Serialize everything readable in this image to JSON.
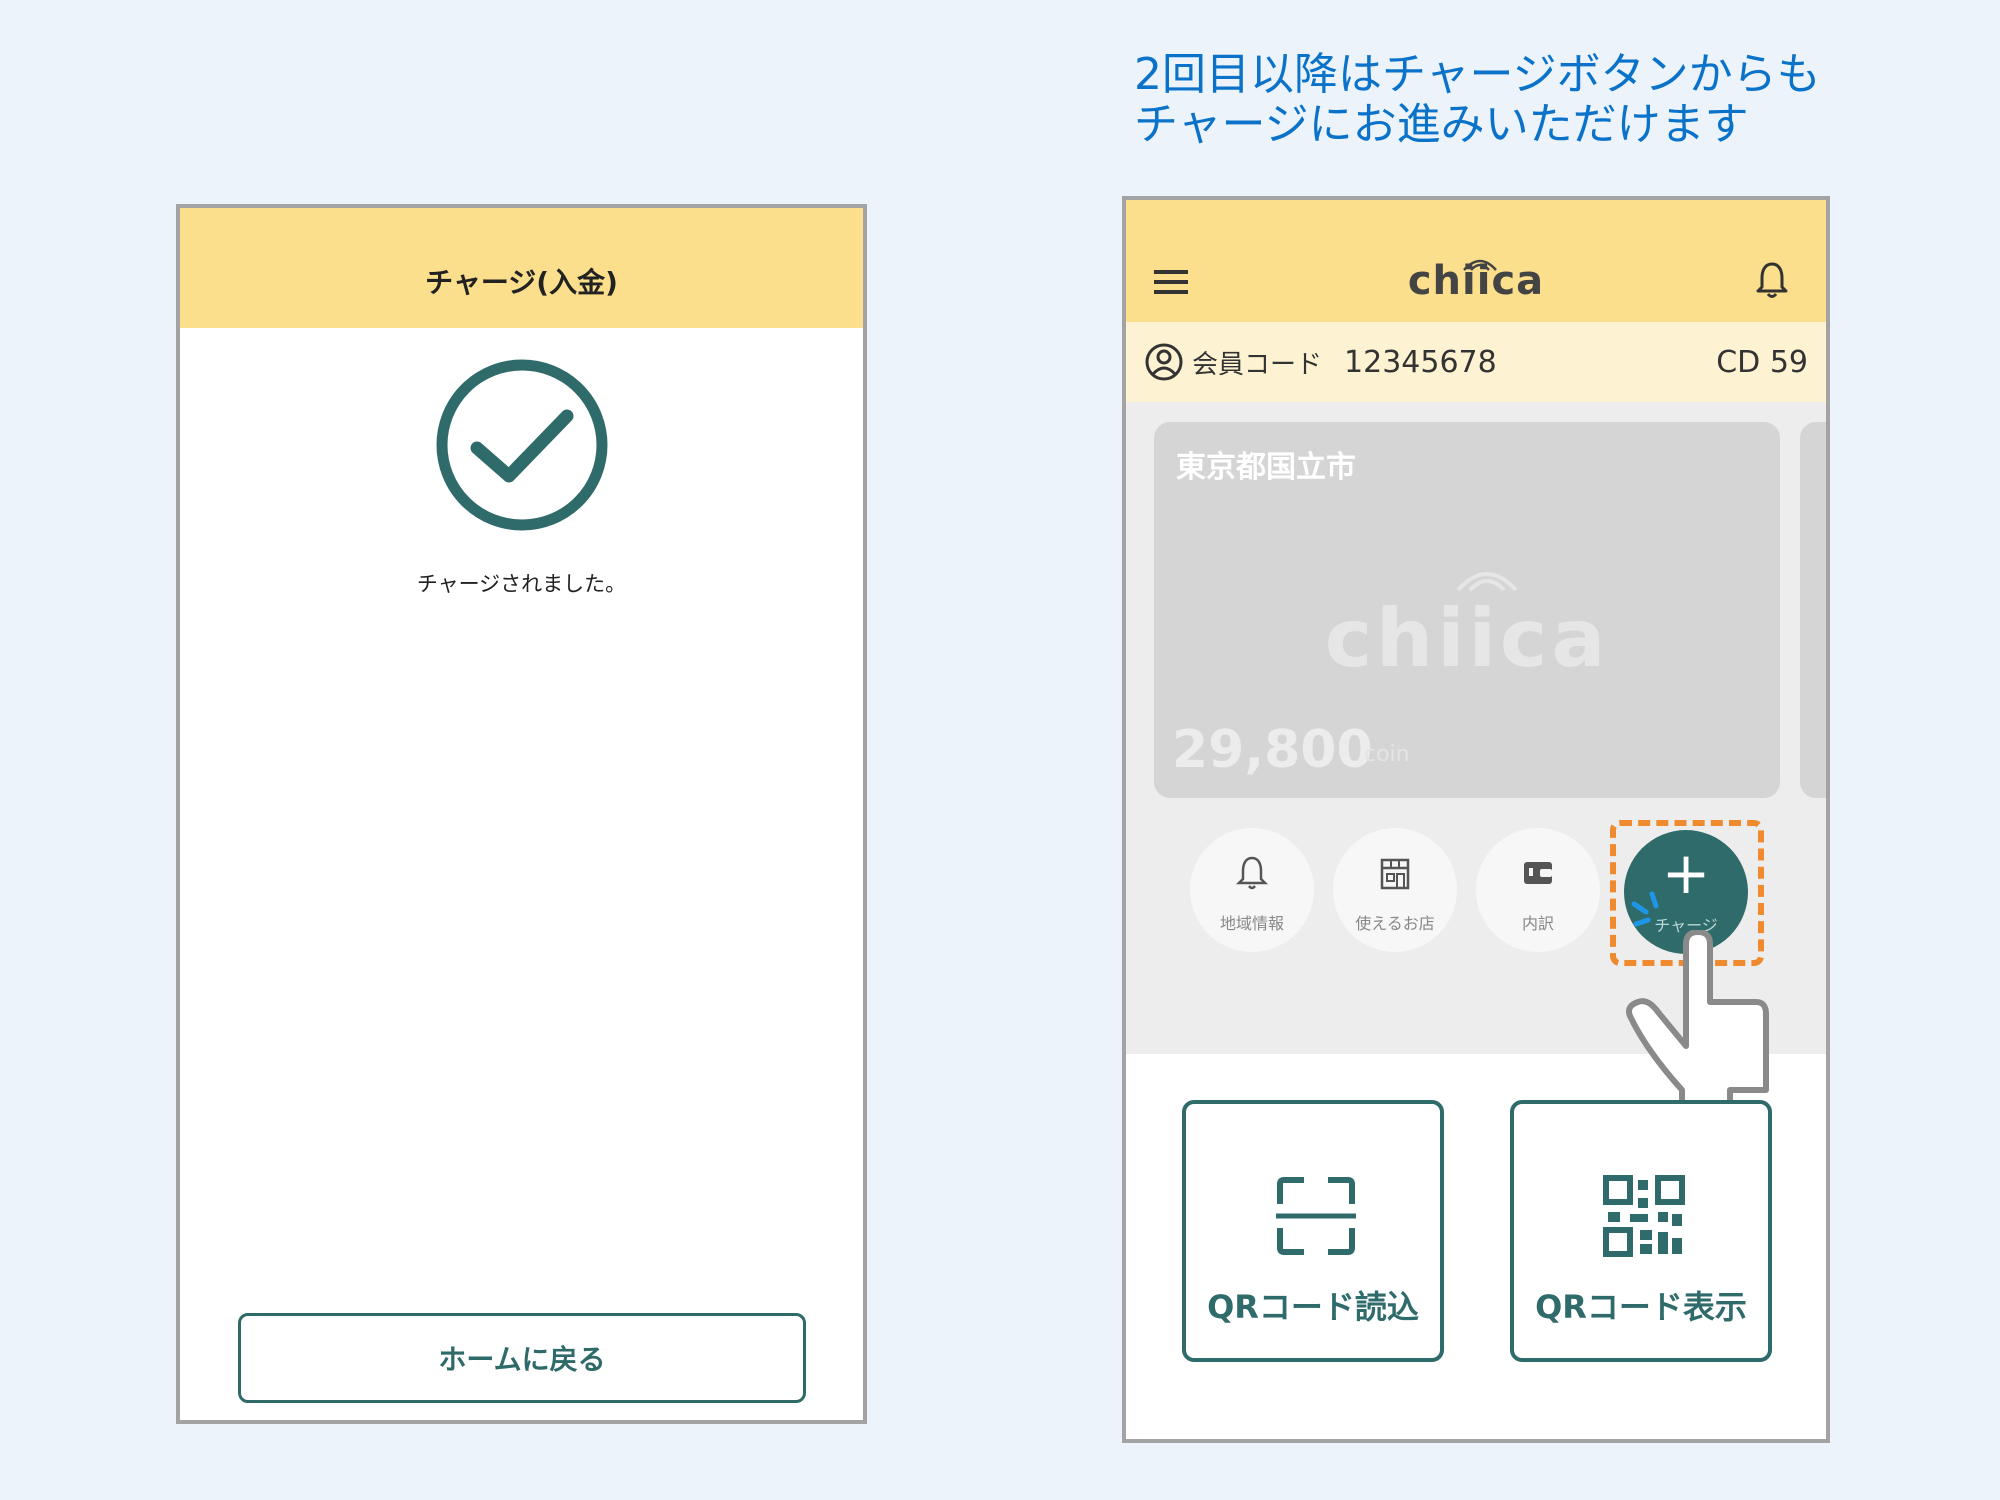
{
  "caption": {
    "line1": "2回目以降はチャージボタンからも",
    "line2": "チャージにお進みいただけます"
  },
  "left_screen": {
    "title": "チャージ(入金)",
    "message": "チャージされました。",
    "home_button_label": "ホームに戻る",
    "check_icon": "check-circle-icon"
  },
  "right_screen": {
    "header": {
      "logo": "chiica",
      "menu_icon": "hamburger-menu-icon",
      "bell_icon": "bell-icon"
    },
    "member": {
      "label": "会員コード",
      "code": "12345678",
      "cd": "CD 59"
    },
    "card": {
      "region": "東京都国立市",
      "watermark": "chiica",
      "balance": "29,800",
      "unit": "coin"
    },
    "actions": [
      {
        "label": "地域情報",
        "icon": "bell-icon"
      },
      {
        "label": "使えるお店",
        "icon": "shop-icon"
      },
      {
        "label": "内訳",
        "icon": "wallet-icon"
      }
    ],
    "charge_button": {
      "symbol": "+",
      "label": "チャージ"
    },
    "qr_buttons": [
      {
        "label": "QRコード読込",
        "icon": "qr-scan-icon"
      },
      {
        "label": "QRコード表示",
        "icon": "qr-code-icon"
      }
    ]
  },
  "colors": {
    "background": "#ecf3fb",
    "header_yellow": "#fbdf8c",
    "teal": "#2f6b6a",
    "caption_blue": "#0a73c9",
    "highlight_orange": "#ef8a2e"
  }
}
